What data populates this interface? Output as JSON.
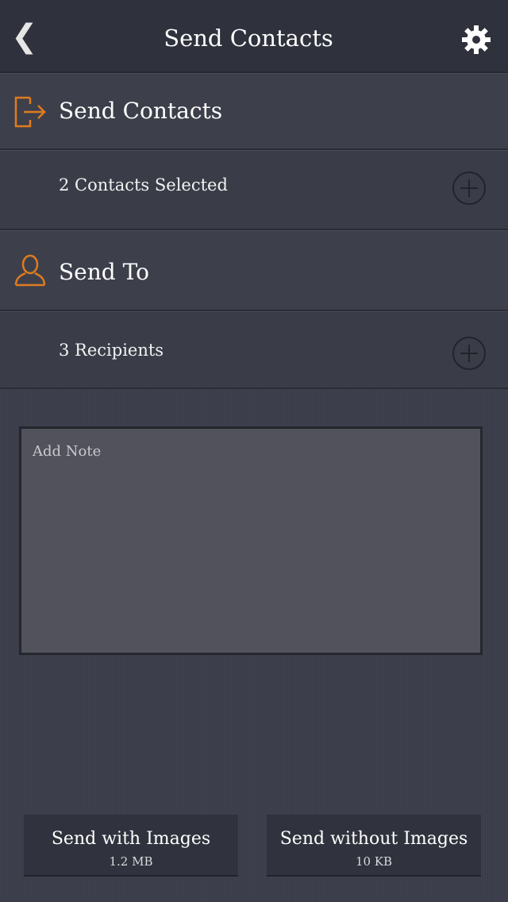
{
  "navbar": {
    "back_icon": "chevron-left-icon",
    "title": "Send Contacts",
    "settings_icon": "gear-icon"
  },
  "contacts_section": {
    "icon": "sign-out-icon",
    "title": "Send Contacts",
    "selection_text": "2 Contacts Selected",
    "add_icon": "plus-circle-icon"
  },
  "recipients_section": {
    "icon": "person-icon",
    "title": "Send To",
    "selection_text": "3 Recipients",
    "add_icon": "plus-circle-icon"
  },
  "note": {
    "placeholder": "Add Note",
    "value": ""
  },
  "actions": {
    "with_images": {
      "label": "Send with Images",
      "size": "1.2 MB"
    },
    "without_images": {
      "label": "Send without Images",
      "size": "10 KB"
    }
  },
  "colors": {
    "accent": "#e07b1f",
    "background": "#3b3e4a",
    "navbar": "#2f323c"
  }
}
